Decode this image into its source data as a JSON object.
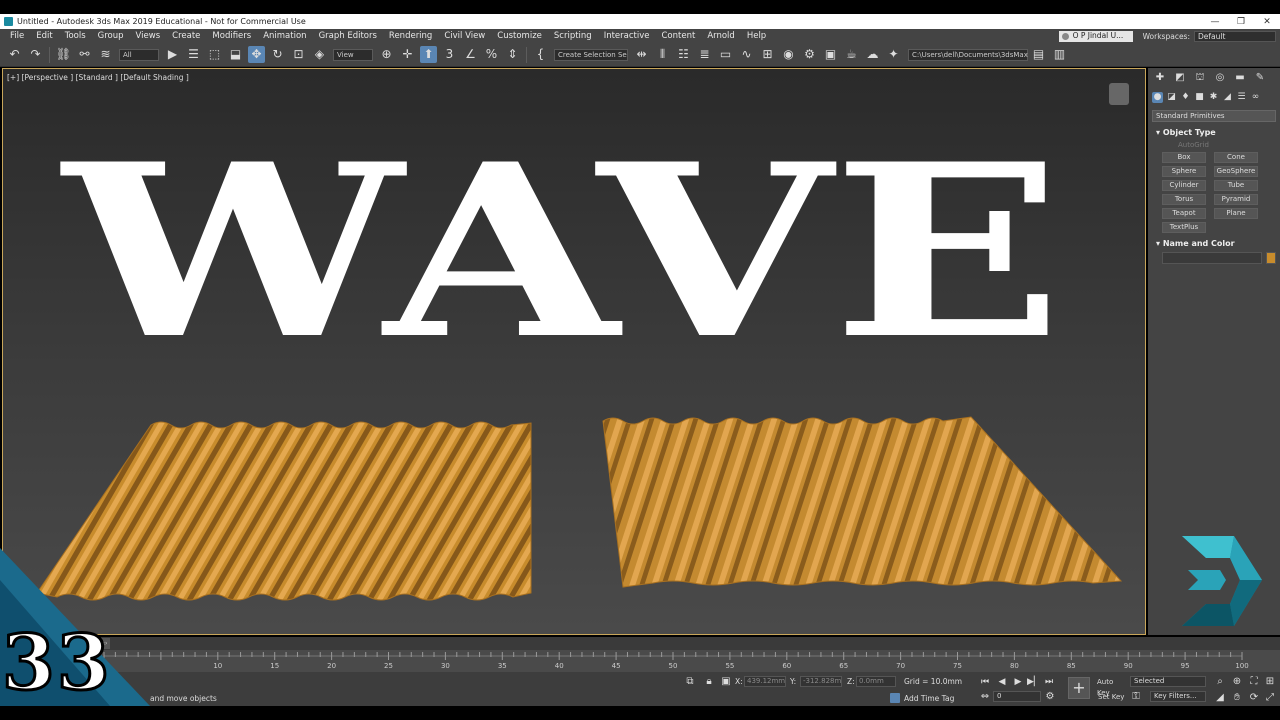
{
  "window": {
    "title": "Untitled - Autodesk 3ds Max 2019 Educational - Not for Commercial Use",
    "controls": [
      "—",
      "❐",
      "✕"
    ]
  },
  "menu": {
    "items": [
      "File",
      "Edit",
      "Tools",
      "Group",
      "Views",
      "Create",
      "Modifiers",
      "Animation",
      "Graph Editors",
      "Rendering",
      "Civil View",
      "Customize",
      "Scripting",
      "Interactive",
      "Content",
      "Arnold",
      "Help"
    ],
    "user": "O P Jindal U...",
    "workspaces_label": "Workspaces:",
    "workspace_value": "Default"
  },
  "toolbar": {
    "filter_select": "All",
    "ref_coord_select": "View",
    "selection_set": "Create Selection Se",
    "path": "C:\\Users\\dell\\Documents\\3dsMax"
  },
  "viewport": {
    "label": "[+] [Perspective ] [Standard ] [Default Shading ]",
    "big_text": "WAVE",
    "plane_color": "#c88c2c"
  },
  "command_panel": {
    "category": "Standard Primitives",
    "object_type_title": "Object Type",
    "autogrid": "AutoGrid",
    "primitives": [
      "Box",
      "Cone",
      "Sphere",
      "GeoSphere",
      "Cylinder",
      "Tube",
      "Torus",
      "Pyramid",
      "Teapot",
      "Plane",
      "TextPlus"
    ],
    "name_color_title": "Name and Color",
    "object_color": "#c88c2c"
  },
  "timeline": {
    "slider_label": "0 / 100",
    "ticks": [
      "10",
      "15",
      "20",
      "25",
      "30",
      "35",
      "40",
      "45",
      "50",
      "55",
      "60",
      "65",
      "70",
      "75",
      "80",
      "85",
      "90",
      "95",
      "100"
    ]
  },
  "status": {
    "prompt": "and move objects",
    "x_label": "X:",
    "x_value": "439.12mm",
    "y_label": "Y:",
    "y_value": "-312.828m",
    "z_label": "Z:",
    "z_value": "0.0mm",
    "grid": "Grid = 10.0mm",
    "add_time_tag": "Add Time Tag",
    "frame": "0",
    "auto_key": "Auto Key",
    "set_key": "Set Key",
    "selected": "Selected",
    "key_filters": "Key Filters..."
  },
  "overlay": {
    "episode_number": "33",
    "logo_color": "#2aa3b8"
  }
}
